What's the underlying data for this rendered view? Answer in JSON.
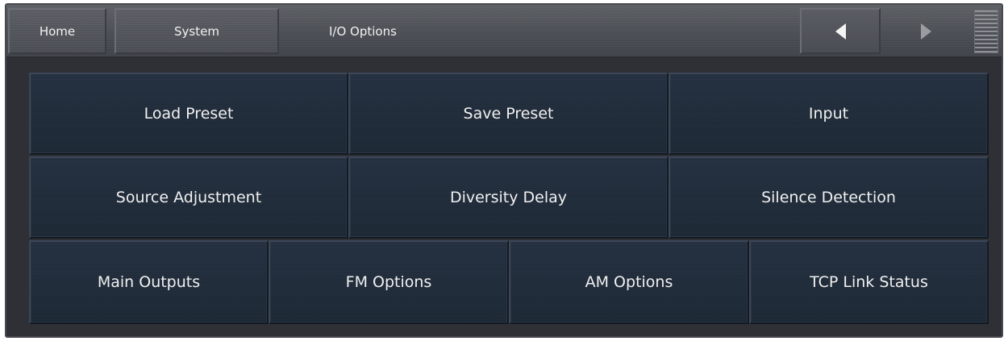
{
  "nav": {
    "home_label": "Home",
    "system_label": "System",
    "current_label": "I/O Options",
    "prev_icon": "triangle-left-icon",
    "next_icon": "triangle-right-icon",
    "menu_icon": "menu-lines-icon"
  },
  "buttons": {
    "row1": [
      "Load Preset",
      "Save Preset",
      "Input"
    ],
    "row2": [
      "Source Adjustment",
      "Diversity Delay",
      "Silence Detection"
    ],
    "row3": [
      "Main Outputs",
      "FM Options",
      "AM Options",
      "TCP Link Status"
    ]
  },
  "colors": {
    "button_bg": "#1f2a37",
    "navbar_bg": "#4f5258",
    "frame_bg": "#2e3036",
    "text": "#f0f0f0"
  }
}
